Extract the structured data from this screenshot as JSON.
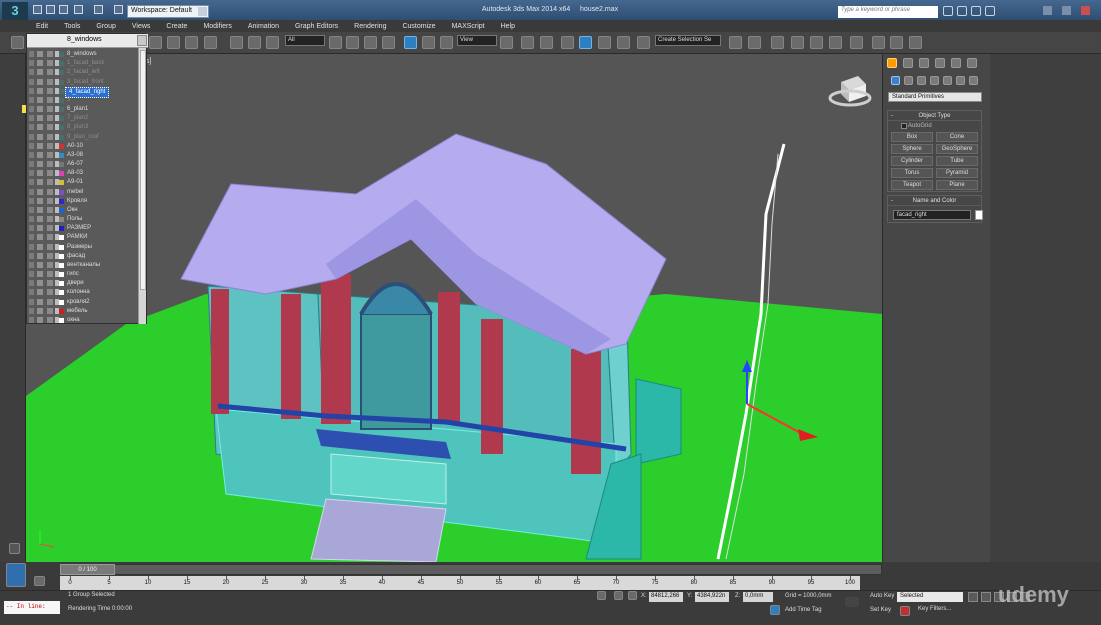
{
  "app": {
    "title": "Autodesk 3ds Max 2014 x64",
    "file": "house2.max",
    "logo_text": "3",
    "workspace": "Workspace: Default",
    "search_placeholder": "Type a keyword or phrase"
  },
  "menu": [
    "Edit",
    "Tools",
    "Group",
    "Views",
    "Create",
    "Modifiers",
    "Animation",
    "Graph Editors",
    "Rendering",
    "Customize",
    "MAXScript",
    "Help"
  ],
  "toolbar": {
    "selection_filter": "All",
    "ref_coord": "View",
    "named_selection": "Create Selection Se"
  },
  "viewport": {
    "label": "[ + ] [ Perspective ] [ Realistic ]",
    "label_visible": "s]"
  },
  "layer_panel": {
    "current_layer": "8_windows",
    "layers": [
      {
        "name": "8_windows",
        "color": "#4a6e6e",
        "dim": false,
        "sel": false
      },
      {
        "name": "1_facad_back",
        "color": "#4a6e6e",
        "dim": true,
        "sel": false
      },
      {
        "name": "2_facad_left",
        "color": "#4a6e6e",
        "dim": true,
        "sel": false
      },
      {
        "name": "3_facad_front",
        "color": "#4a6e6e",
        "dim": true,
        "sel": false
      },
      {
        "name": "4_facad_right",
        "color": "#4a6e6e",
        "dim": false,
        "sel": true
      },
      {
        "name": "5",
        "color": "#4a6e6e",
        "dim": true,
        "sel": false
      },
      {
        "name": "6_plan1",
        "color": "#4a6e6e",
        "dim": false,
        "sel": false
      },
      {
        "name": "7_plan2",
        "color": "#4a6e6e",
        "dim": true,
        "sel": false
      },
      {
        "name": "8_plan3",
        "color": "#4a6e6e",
        "dim": true,
        "sel": false
      },
      {
        "name": "9_plan_roof",
        "color": "#4a6e6e",
        "dim": true,
        "sel": false
      },
      {
        "name": "A0-10",
        "color": "#cc3333",
        "dim": false,
        "sel": false
      },
      {
        "name": "A3-08",
        "color": "#2e8ec6",
        "dim": false,
        "sel": false
      },
      {
        "name": "A6-07",
        "color": "#777777",
        "dim": false,
        "sel": false
      },
      {
        "name": "A8-03",
        "color": "#e040c0",
        "dim": false,
        "sel": false
      },
      {
        "name": "A9-01",
        "color": "#d0c040",
        "dim": false,
        "sel": false
      },
      {
        "name": "mebel",
        "color": "#8050c0",
        "dim": false,
        "sel": false
      },
      {
        "name": "Кровля",
        "color": "#2a2ad0",
        "dim": false,
        "sel": false
      },
      {
        "name": "Окн",
        "color": "#2060d0",
        "dim": false,
        "sel": false
      },
      {
        "name": "Полы",
        "color": "#888888",
        "dim": false,
        "sel": false
      },
      {
        "name": "РАЗМЕР",
        "color": "#2020c0",
        "dim": false,
        "sel": false
      },
      {
        "name": "РАМКИ",
        "color": "#ffffff",
        "dim": false,
        "sel": false
      },
      {
        "name": "Размеры",
        "color": "#ffffff",
        "dim": false,
        "sel": false
      },
      {
        "name": "фасад",
        "color": "#ffffff",
        "dim": false,
        "sel": false
      },
      {
        "name": "вентканалы",
        "color": "#ffffff",
        "dim": false,
        "sel": false
      },
      {
        "name": "гипс",
        "color": "#ffffff",
        "dim": false,
        "sel": false
      },
      {
        "name": "двери",
        "color": "#ffffff",
        "dim": false,
        "sel": false
      },
      {
        "name": "колонна",
        "color": "#ffffff",
        "dim": false,
        "sel": false
      },
      {
        "name": "кровля2",
        "color": "#ffffff",
        "dim": false,
        "sel": false
      },
      {
        "name": "мебель",
        "color": "#cc2020",
        "dim": false,
        "sel": false
      },
      {
        "name": "окна",
        "color": "#ffffff",
        "dim": false,
        "sel": false
      }
    ]
  },
  "command_panel": {
    "category": "Standard Primitives",
    "object_type_title": "Object Type",
    "autogrid": "AutoGrid",
    "buttons": [
      "Box",
      "Cone",
      "Sphere",
      "GeoSphere",
      "Cylinder",
      "Tube",
      "Torus",
      "Pyramid",
      "Teapot",
      "Plane"
    ],
    "name_color_title": "Name and Color",
    "object_name": "facad_right",
    "object_color": "#ffffff"
  },
  "timeline": {
    "slider": "0 / 100",
    "ticks": [
      0,
      5,
      10,
      15,
      20,
      25,
      30,
      35,
      40,
      45,
      50,
      55,
      60,
      65,
      70,
      75,
      80,
      85,
      90,
      95,
      100
    ]
  },
  "status": {
    "maxscript": "-- In line:",
    "selection": "1 Group Selected",
    "render_time": "Rendering Time  0:00:00",
    "x_label": "X:",
    "x": "84812,266",
    "y_label": "Y:",
    "y": "4384,922n",
    "z_label": "Z:",
    "z": "0,0mm",
    "grid": "Grid = 1000,0mm",
    "add_time_tag": "Add Time Tag",
    "auto_key": "Auto Key",
    "set_key": "Set Key",
    "selected": "Selected",
    "key_filters": "Key Filters...",
    "watermark": "udemy"
  }
}
